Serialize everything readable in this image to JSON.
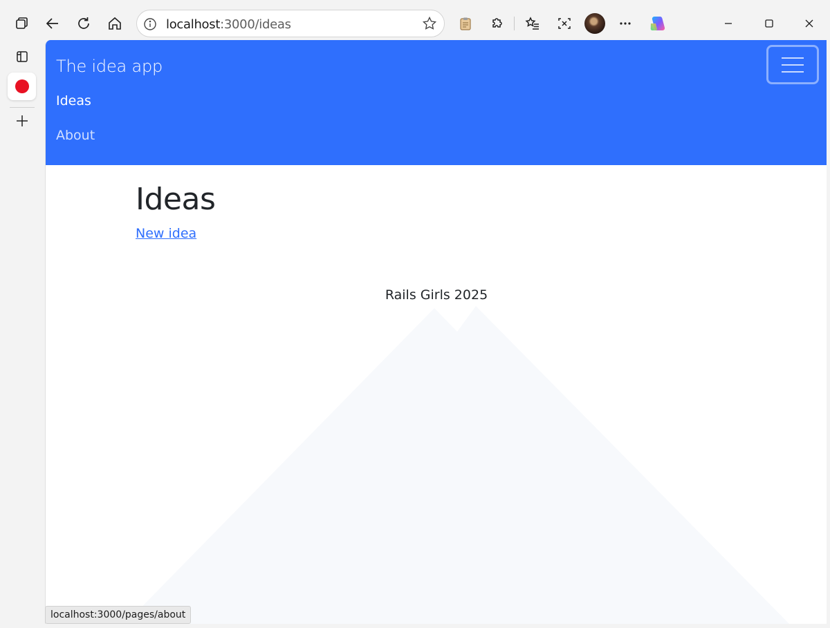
{
  "browser": {
    "url_host": "localhost",
    "url_path": ":3000/ideas",
    "status_url": "localhost:3000/pages/about"
  },
  "icons": {
    "tab_actions": "tab-actions-icon",
    "back": "back-arrow-icon",
    "refresh": "refresh-icon",
    "home": "home-icon",
    "info": "info-icon",
    "favorite": "star-icon",
    "collections": "clipboard-icon",
    "extensions": "puzzle-icon",
    "favorites_bar": "favorites-icon",
    "screenshot": "screenshot-icon",
    "more": "more-icon",
    "copilot": "copilot-icon",
    "vertical_tabs": "vertical-tabs-icon",
    "new_tab": "plus-icon"
  },
  "app": {
    "brand": "The idea app",
    "nav": [
      {
        "label": "Ideas"
      },
      {
        "label": "About"
      }
    ],
    "page_title": "Ideas",
    "new_link": "New idea",
    "footer": "Rails Girls 2025"
  },
  "colors": {
    "navbar": "#2f6ffd",
    "record": "#e81123",
    "link": "#2f6ffd"
  }
}
